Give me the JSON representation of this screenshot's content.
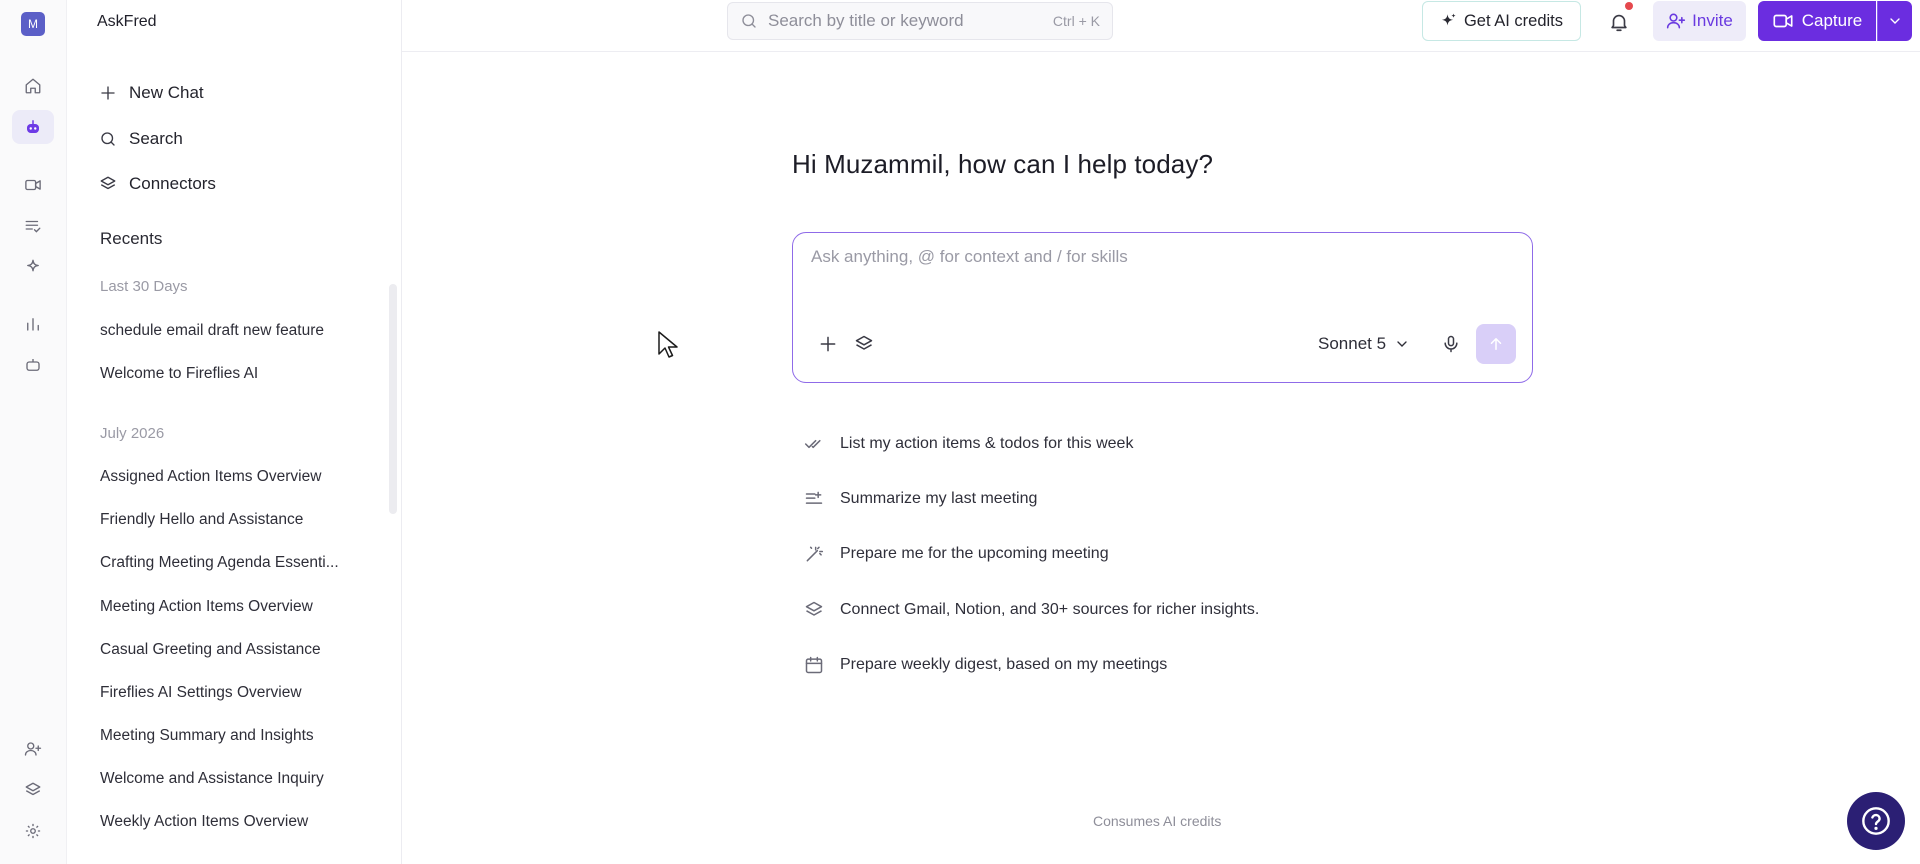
{
  "rail": {
    "avatar_letter": "M",
    "items": [
      {
        "icon": "home-icon"
      },
      {
        "icon": "bot-icon",
        "active": true
      },
      {
        "icon": "video-icon"
      },
      {
        "icon": "list-check-icon"
      },
      {
        "icon": "sparkle-icon"
      },
      {
        "icon": "chart-icon"
      },
      {
        "icon": "robot-icon"
      }
    ],
    "bottom_items": [
      {
        "icon": "user-plus-icon"
      },
      {
        "icon": "layers-icon"
      },
      {
        "icon": "gear-icon"
      }
    ]
  },
  "sidebar": {
    "title": "AskFred",
    "actions": [
      {
        "label": "New Chat",
        "icon": "plus-icon"
      },
      {
        "label": "Search",
        "icon": "search-icon"
      },
      {
        "label": "Connectors",
        "icon": "layers-icon"
      }
    ],
    "recents_title": "Recents",
    "groups": [
      {
        "label": "Last 30 Days",
        "items": [
          "schedule email draft new feature",
          "Welcome to Fireflies AI"
        ]
      },
      {
        "label": "July 2026",
        "items": [
          "Assigned Action Items Overview",
          "Friendly Hello and Assistance",
          "Crafting Meeting Agenda Essenti...",
          "Meeting Action Items Overview",
          "Casual Greeting and Assistance",
          "Fireflies AI Settings Overview",
          "Meeting Summary and Insights",
          "Welcome and Assistance Inquiry",
          "Weekly Action Items Overview"
        ]
      }
    ]
  },
  "topbar": {
    "search_placeholder": "Search by title or keyword",
    "search_shortcut": "Ctrl + K",
    "ai_credits_label": "Get AI credits",
    "invite_label": "Invite",
    "capture_label": "Capture"
  },
  "main": {
    "greeting": "Hi Muzammil, how can I help today?",
    "composer_placeholder": "Ask anything, @ for context and / for skills",
    "model": "Sonnet 5",
    "suggestions": [
      {
        "label": "List my action items & todos for this week",
        "icon": "double-check-icon"
      },
      {
        "label": "Summarize my last meeting",
        "icon": "list-plus-icon"
      },
      {
        "label": "Prepare me for the upcoming meeting",
        "icon": "magic-wand-icon"
      },
      {
        "label": "Connect Gmail, Notion, and 30+ sources for richer insights.",
        "icon": "layers-icon"
      },
      {
        "label": "Prepare weekly digest, based on my meetings",
        "icon": "calendar-icon"
      }
    ],
    "footnote": "Consumes AI credits"
  },
  "colors": {
    "accent": "#6b2de0",
    "accent_soft": "#eeecf9",
    "composer_border": "#8f6be8",
    "help_button": "#2b1f74",
    "notification_dot": "#e5484d"
  }
}
